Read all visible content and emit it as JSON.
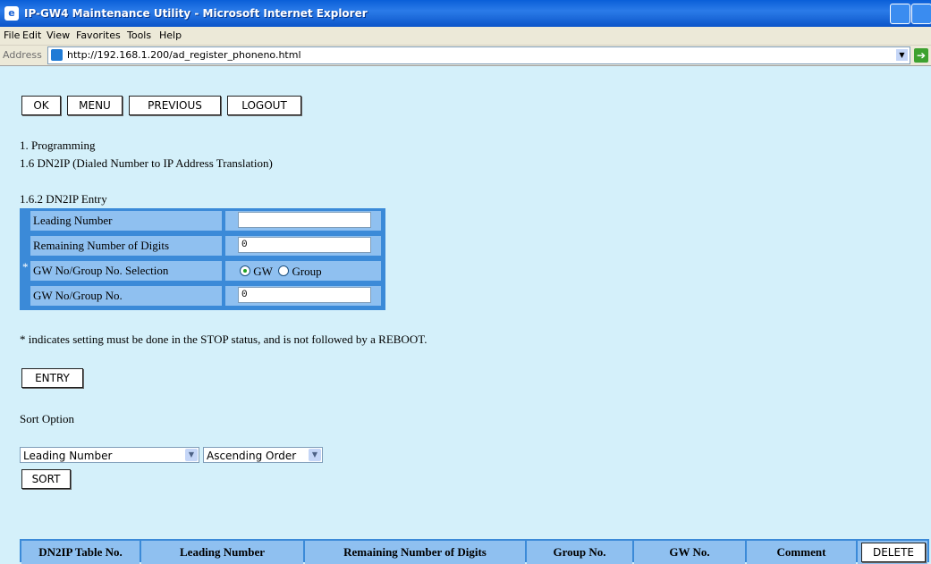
{
  "window": {
    "title": "IP-GW4 Maintenance Utility - Microsoft Internet Explorer"
  },
  "menu": [
    "File",
    "Edit",
    "View",
    "Favorites",
    "Tools",
    "Help"
  ],
  "address": {
    "label": "Address",
    "url": "http://192.168.1.200/ad_register_phoneno.html"
  },
  "nav_buttons": {
    "ok": "OK",
    "menu": "MENU",
    "previous": "PREVIOUS",
    "logout": "LOGOUT"
  },
  "breadcrumb": {
    "level1": "1. Programming",
    "level2": "1.6 DN2IP (Dialed Number to IP Address Translation)"
  },
  "entry": {
    "heading": "1.6.2 DN2IP Entry",
    "star": "*",
    "fields": {
      "leading_number": {
        "label": "Leading Number",
        "value": ""
      },
      "remaining_digits": {
        "label": "Remaining Number of Digits",
        "value": "0"
      },
      "selection": {
        "label": "GW No/Group No. Selection",
        "options": [
          "GW",
          "Group"
        ],
        "selected": "GW"
      },
      "gw_group_no": {
        "label": "GW No/Group No.",
        "value": "0"
      }
    }
  },
  "note": "* indicates setting must be done in the STOP status, and is not followed by a REBOOT.",
  "entry_button": "ENTRY",
  "sort": {
    "label": "Sort Option",
    "field_selected": "Leading Number",
    "order_selected": "Ascending Order",
    "button": "SORT"
  },
  "table": {
    "headers": [
      "DN2IP Table No.",
      "Leading Number",
      "Remaining Number of Digits",
      "Group No.",
      "GW No.",
      "Comment"
    ],
    "delete_button": "DELETE"
  },
  "colors": {
    "page_bg": "#d4f0fa",
    "table_border": "#3b8ad8",
    "cell_bg": "#8fc0f0",
    "titlebar": "#0a5fd8"
  }
}
